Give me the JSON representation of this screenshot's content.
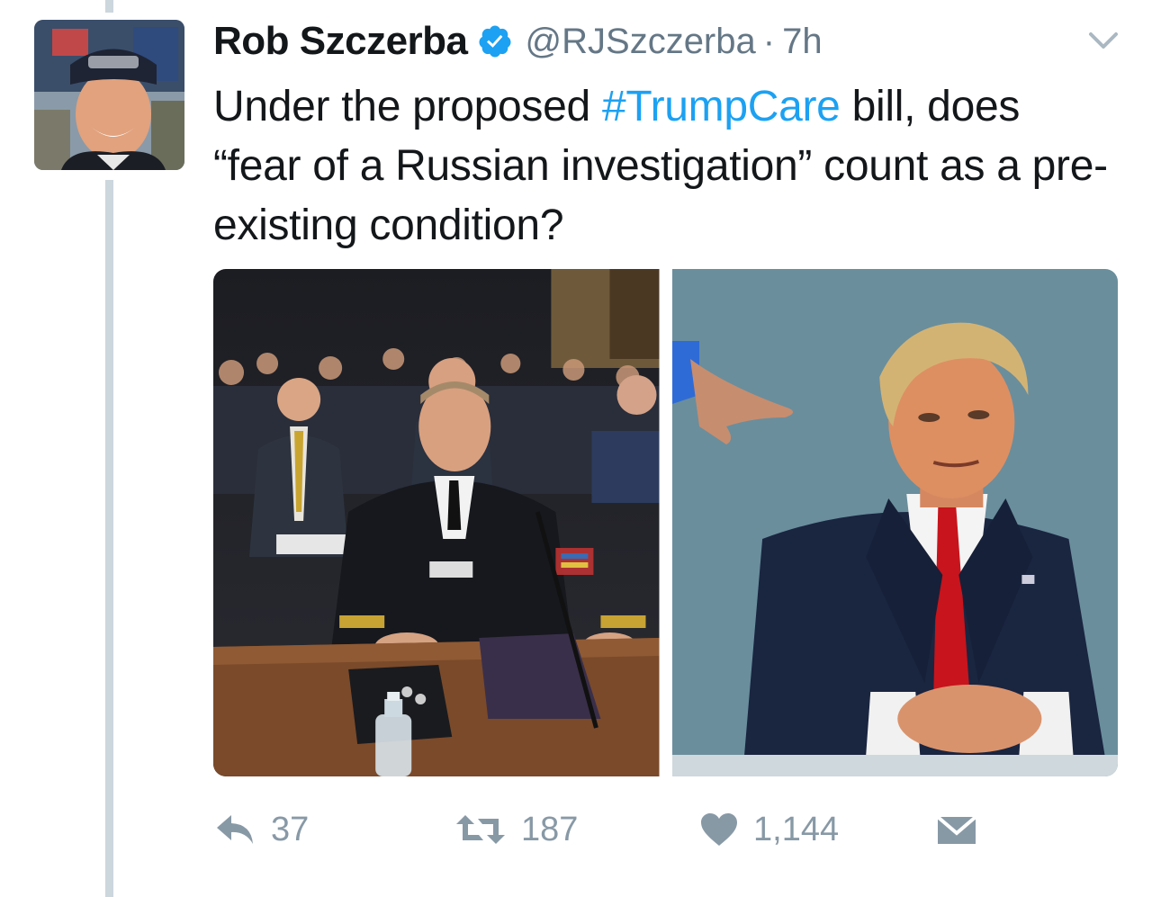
{
  "user": {
    "display_name": "Rob Szczerba",
    "handle": "@RJSzczerba",
    "separator": "·",
    "time": "7h",
    "verified": true
  },
  "tweet": {
    "text_before": "Under the proposed ",
    "hashtag": "#TrumpCare",
    "text_after": " bill, does “fear of a Russian investigation” count as a pre-existing condition?"
  },
  "media": {
    "photos": [
      {
        "subject": "hearing-witness-photo"
      },
      {
        "subject": "seated-man-red-tie-photo"
      }
    ]
  },
  "actions": {
    "reply_count": "37",
    "retweet_count": "187",
    "like_count": "1,144"
  },
  "colors": {
    "link": "#1da1f2",
    "muted": "#657786",
    "action": "#8899a6",
    "thread": "#ccd6dd"
  }
}
